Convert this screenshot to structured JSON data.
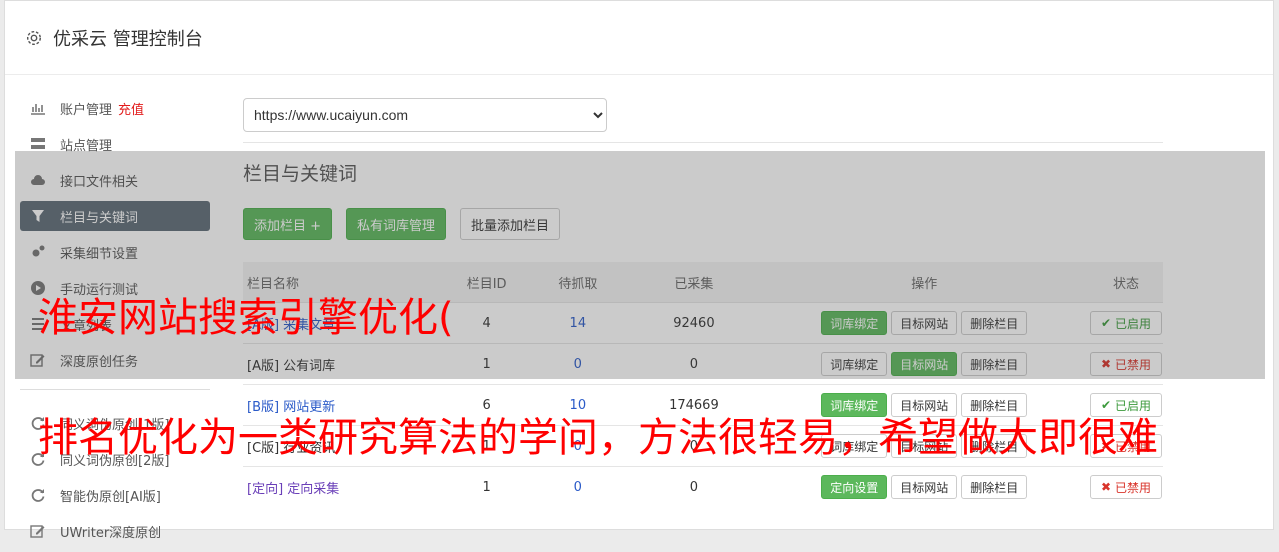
{
  "header": {
    "title": "优采云 管理控制台"
  },
  "sidebar": {
    "items": [
      {
        "label": "账户管理",
        "extra": "充值",
        "icon": "bar-chart-icon"
      },
      {
        "label": "站点管理",
        "icon": "server-icon"
      },
      {
        "label": "接口文件相关",
        "icon": "cloud-upload-icon"
      },
      {
        "label": "栏目与关键词",
        "icon": "filter-icon",
        "active": true
      },
      {
        "label": "采集细节设置",
        "icon": "cogs-icon"
      },
      {
        "label": "手动运行测试",
        "icon": "play-icon"
      },
      {
        "label": "文章列表",
        "icon": "list-icon"
      },
      {
        "label": "深度原创任务",
        "icon": "edit-icon"
      }
    ],
    "items2": [
      {
        "label": "同义词伪原创[1版]",
        "icon": "refresh-icon"
      },
      {
        "label": "同义词伪原创[2版]",
        "icon": "refresh-icon"
      },
      {
        "label": "智能伪原创[AI版]",
        "icon": "refresh-icon"
      },
      {
        "label": "UWriter深度原创",
        "icon": "edit-icon"
      }
    ]
  },
  "site_select": {
    "value": "https://www.ucaiyun.com"
  },
  "section": {
    "title": "栏目与关键词"
  },
  "toolbar": {
    "add_column": "添加栏目 +",
    "private_lexicon": "私有词库管理",
    "batch_add": "批量添加栏目"
  },
  "table": {
    "headers": [
      "栏目名称",
      "栏目ID",
      "待抓取",
      "已采集",
      "操作",
      "状态"
    ],
    "rows": [
      {
        "name": "[A版] 采集文章",
        "id": "4",
        "pending": "14",
        "collected": "92460",
        "status": "已启用"
      },
      {
        "name": "[A版] 公有词库",
        "id": "1",
        "pending": "0",
        "collected": "0",
        "status": "已禁用"
      },
      {
        "name": "[B版] 网站更新",
        "id": "6",
        "pending": "10",
        "collected": "174669",
        "status": "已启用"
      },
      {
        "name": "[C版] 行业资讯",
        "id": "1",
        "pending": "0",
        "collected": "0",
        "status": "已禁用"
      },
      {
        "name": "[定向] 定向采集",
        "id": "1",
        "pending": "0",
        "collected": "0",
        "status": "已禁用"
      }
    ],
    "op_labels": {
      "bind": "词库绑定",
      "target": "目标网站",
      "delete": "删除栏目",
      "direct": "定向设置"
    }
  },
  "watermark": {
    "line1": "淮安网站搜索引擎优化(",
    "line2": "排名优化为一类研究算法的学问，方法很轻易，希望做大即很难"
  }
}
